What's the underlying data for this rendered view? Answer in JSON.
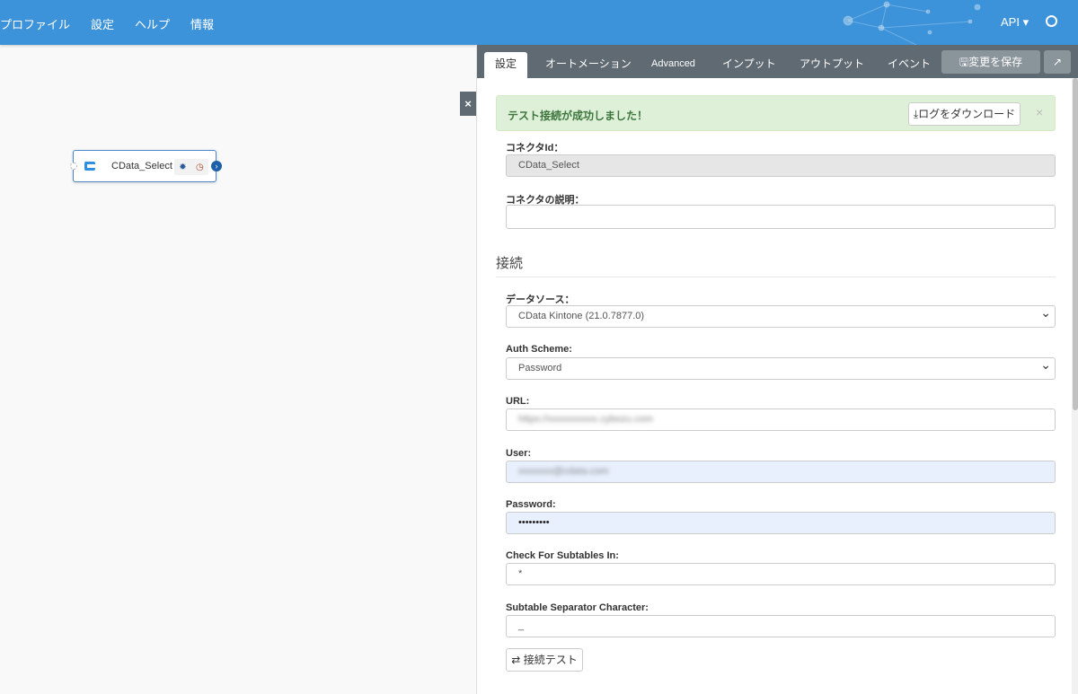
{
  "header": {
    "nav": [
      "プロファイル",
      "設定",
      "ヘルプ",
      "情報"
    ],
    "api_menu": "API ▾",
    "user_icon": "user-circle-icon",
    "color": "#3d93d9"
  },
  "canvas": {
    "node": {
      "label": "CData_Select",
      "icon": "cdata-connector-icon"
    }
  },
  "panel": {
    "tabs": [
      "設定",
      "オートメーション",
      "Advanced",
      "インプット",
      "アウトプット",
      "イベント"
    ],
    "save_label": "変更を保存",
    "alert": {
      "message": "テスト接続が成功しました！",
      "download_label": "ログをダウンロード",
      "close": "×"
    },
    "fields": {
      "connector_id": {
        "label": "コネクタId：",
        "value": "CData_Select"
      },
      "description": {
        "label": "コネクタの説明：",
        "value": ""
      },
      "section": "接続",
      "datasource": {
        "label": "データソース：",
        "value": "CData Kintone (21.0.7877.0)"
      },
      "auth": {
        "label": "Auth Scheme:",
        "value": "Password"
      },
      "url": {
        "label": "URL:",
        "value": "https://xxxxxxxxxx.cybozu.com"
      },
      "user": {
        "label": "User:",
        "value": "xxxxxxx@cdata.com"
      },
      "password": {
        "label": "Password:",
        "value": "•••••••••"
      },
      "subtables": {
        "label": "Check For Subtables In:",
        "value": "*"
      },
      "separator": {
        "label": "Subtable Separator Character:",
        "value": "_"
      }
    },
    "test_label": "接続テスト"
  }
}
